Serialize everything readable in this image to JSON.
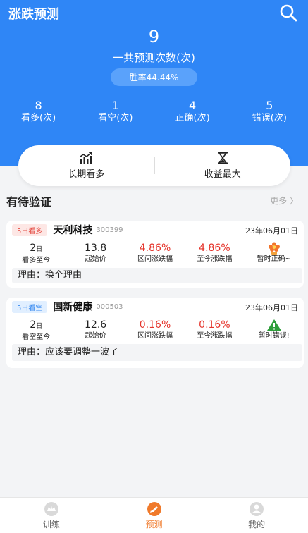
{
  "header": {
    "title": "涨跌预测",
    "search_icon": "search-icon"
  },
  "summary": {
    "total": "9",
    "total_label": "一共预测次数(次)",
    "win_rate": "胜率44.44%"
  },
  "stats": [
    {
      "value": "8",
      "label": "看多(次)"
    },
    {
      "value": "1",
      "label": "看空(次)"
    },
    {
      "value": "4",
      "label": "正确(次)"
    },
    {
      "value": "5",
      "label": "错误(次)"
    }
  ],
  "rankings": [
    {
      "label": "长期看多",
      "icon": "trend-up-chart-icon"
    },
    {
      "label": "收益最大",
      "icon": "hourglass-icon"
    }
  ],
  "pending": {
    "title": "有待验证",
    "more": "更多 〉"
  },
  "cards": [
    {
      "tag": "5日看多",
      "name": "天利科技",
      "code": "300399",
      "date": "23年06月01日",
      "days_value": "2",
      "days_unit": "日",
      "days_label": "看多至今",
      "start_price": "13.8",
      "start_price_label": "起始价",
      "range_change": "4.86%",
      "range_change_label": "区间涨跌幅",
      "to_date_change": "4.86%",
      "to_date_change_label": "至今涨跌幅",
      "status": "暂时正确~",
      "status_icon": "correct-flower-icon",
      "reason": "理由：换个理由"
    },
    {
      "tag": "5日看空",
      "name": "国新健康",
      "code": "000503",
      "date": "23年06月01日",
      "days_value": "2",
      "days_unit": "日",
      "days_label": "看空至今",
      "start_price": "12.6",
      "start_price_label": "起始价",
      "range_change": "0.16%",
      "range_change_label": "区间涨跌幅",
      "to_date_change": "0.16%",
      "to_date_change_label": "至今涨跌幅",
      "status": "暂时错误!",
      "status_icon": "warning-triangle-icon",
      "reason": "理由：应该要调整一波了"
    }
  ],
  "tabs": [
    {
      "label": "训练",
      "icon": "training-icon",
      "active": false
    },
    {
      "label": "预测",
      "icon": "prediction-icon",
      "active": true
    },
    {
      "label": "我的",
      "icon": "profile-icon",
      "active": false
    }
  ],
  "colors": {
    "primary": "#2f86f6",
    "up": "#e5332a",
    "active_tab": "#f07a2b"
  }
}
